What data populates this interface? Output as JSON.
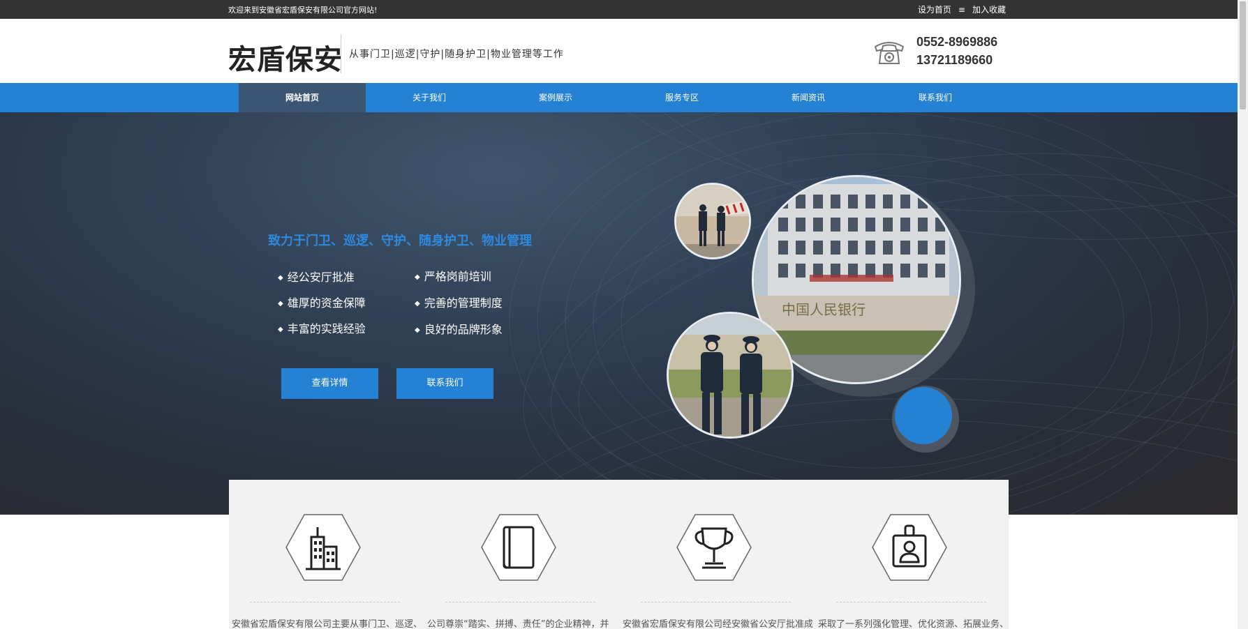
{
  "topbar": {
    "welcome": "欢迎来到安徽省宏盾保安有限公司官方网站!",
    "set_home": "设为首页",
    "separator": "≡",
    "bookmark": "加入收藏"
  },
  "header": {
    "logo": "宏盾保安",
    "tagline": "从事门卫|巡逻|守护|随身护卫|物业管理等工作",
    "phone_icon": "telephone-icon",
    "phone1": "0552-8969886",
    "phone2": "13721189660"
  },
  "nav": {
    "items": [
      "网站首页",
      "关于我们",
      "案例展示",
      "服务专区",
      "新闻资讯",
      "联系我们"
    ],
    "active": "网站首页"
  },
  "hero": {
    "title": "致力于门卫、巡逻、守护、随身护卫、物业管理",
    "features_left": [
      "经公安厅批准",
      "雄厚的资金保障",
      "丰富的实践经验"
    ],
    "features_right": [
      "严格岗前培训",
      "完善的管理制度",
      "良好的品牌形象"
    ],
    "bullet": "◆",
    "btn_details": "查看详情",
    "btn_contact": "联系我们",
    "bank_sign": "中国人民银行"
  },
  "features": [
    {
      "icon": "building-icon",
      "text": "安徽省宏盾保安有限公司主要从事门卫、巡逻、"
    },
    {
      "icon": "book-icon",
      "text": "公司尊崇“踏实、拼搏、责任”的企业精神，并"
    },
    {
      "icon": "trophy-icon",
      "text": "安徽省宏盾保安有限公司经安徽省公安厅批准成"
    },
    {
      "icon": "id-badge-icon",
      "text": "采取了一系列强化管理、优化资源、拓展业务、"
    }
  ],
  "colors": {
    "accent": "#2581d4",
    "nav_active": "#3a5673",
    "topbar": "#333333",
    "hero_title": "#2d8ae0"
  }
}
